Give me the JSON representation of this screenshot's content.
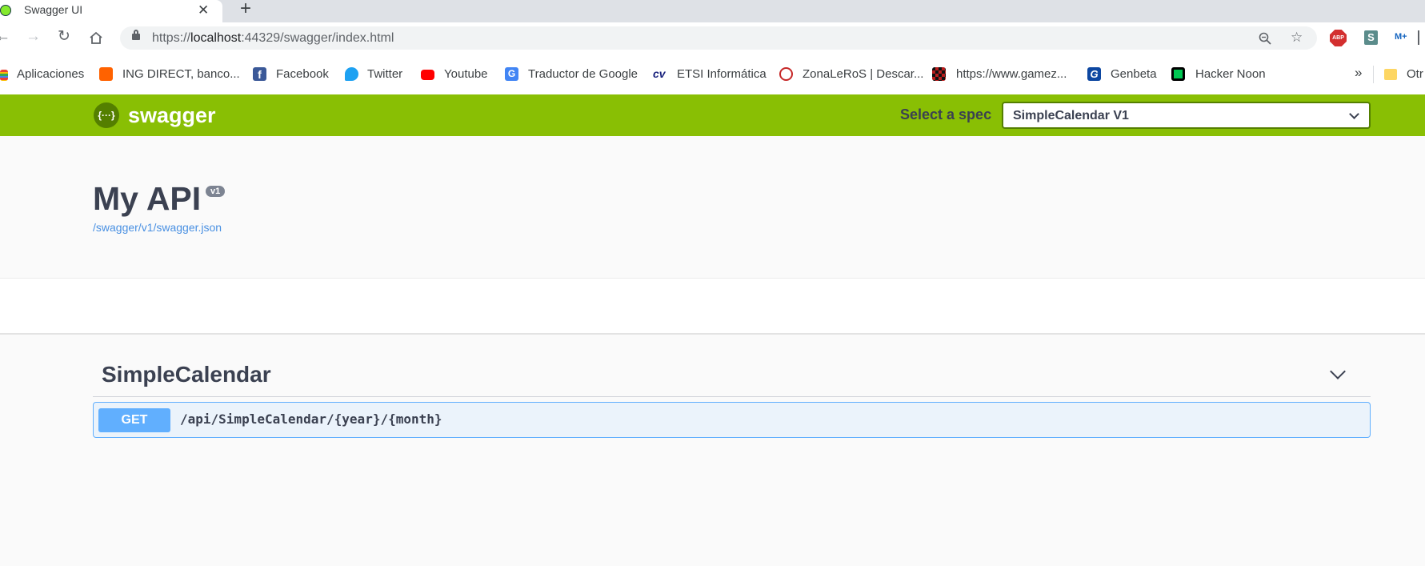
{
  "browser": {
    "tab_title": "Swagger UI",
    "tab_close": "✕",
    "new_tab": "+",
    "url_scheme": "https://",
    "url_host": "localhost",
    "url_rest": ":44329/swagger/index.html",
    "bookmarks": [
      {
        "label": "Aplicaciones",
        "icon": "apps-grid-icon",
        "color": "#e94235"
      },
      {
        "label": "ING DIRECT, banco...",
        "icon": "ing-icon",
        "color": "#ff6200"
      },
      {
        "label": "Facebook",
        "icon": "facebook-icon",
        "color": "#3b5998"
      },
      {
        "label": "Twitter",
        "icon": "twitter-icon",
        "color": "#1da1f2"
      },
      {
        "label": "Youtube",
        "icon": "youtube-icon",
        "color": "#ff0000"
      },
      {
        "label": "Traductor de Google",
        "icon": "translate-icon",
        "color": "#4285f4"
      },
      {
        "label": "ETSI Informática",
        "icon": "etsi-icon",
        "color": "#1a237e"
      },
      {
        "label": "ZonaLeRoS | Descar...",
        "icon": "zonaleros-icon",
        "color": "#c62828"
      },
      {
        "label": "https://www.gamez...",
        "icon": "gamez-icon",
        "color": "#b71c1c"
      },
      {
        "label": "Genbeta",
        "icon": "genbeta-icon",
        "color": "#0d47a1"
      },
      {
        "label": "Hacker Noon",
        "icon": "hackernoon-icon",
        "color": "#00c853"
      }
    ],
    "overflow": "»",
    "other_bookmarks": "Otr"
  },
  "topbar": {
    "logo_symbol": "{···}",
    "logo_text": "swagger",
    "spec_label": "Select a spec",
    "spec_value": "SimpleCalendar V1"
  },
  "info": {
    "title": "My API",
    "version": "v1",
    "link": "/swagger/v1/swagger.json"
  },
  "operations": {
    "tag": "SimpleCalendar",
    "endpoints": [
      {
        "method": "GET",
        "path": "/api/SimpleCalendar/{year}/{month}"
      }
    ]
  },
  "colors": {
    "topbar": "#89bf04",
    "get": "#61affe",
    "text": "#3b4151"
  }
}
